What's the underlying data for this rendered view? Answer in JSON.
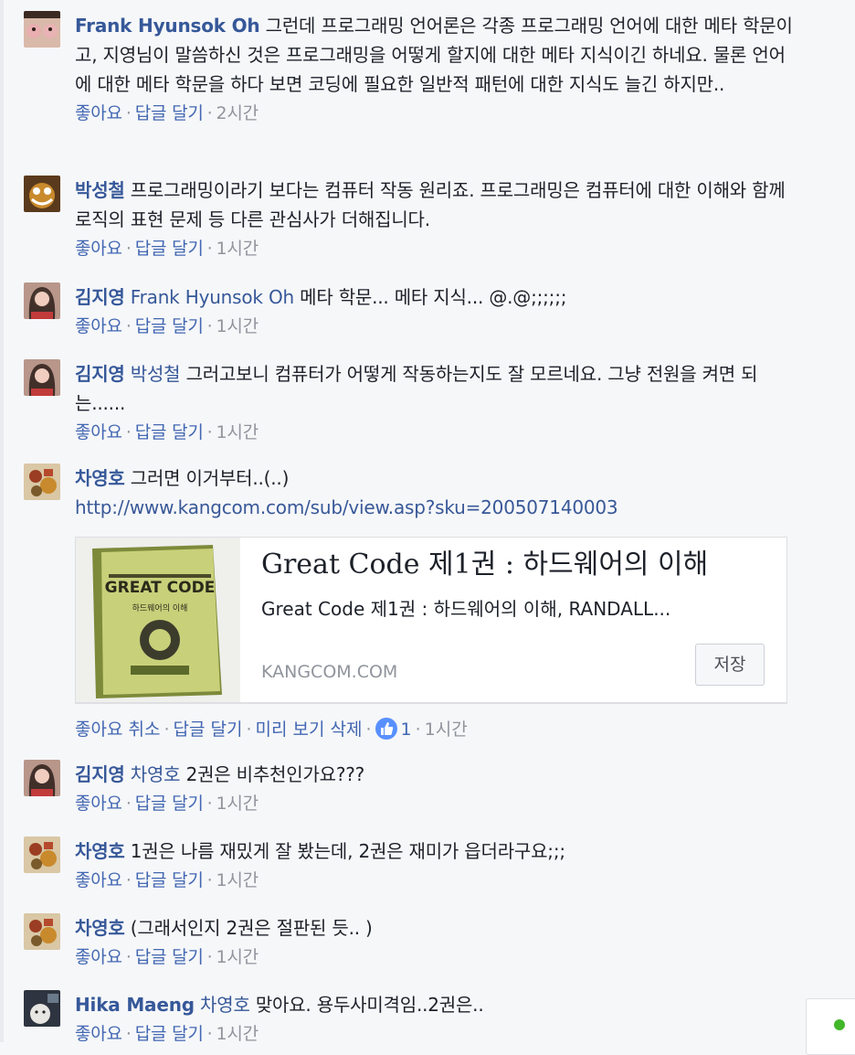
{
  "comments": [
    {
      "author": "Frank Hyunsok Oh",
      "mention": "",
      "text": "그런데 프로그래밍 언어론은 각종 프로그래밍 언어에 대한 메타 학문이고, 지영님이 말씀하신 것은 프로그래밍을 어떻게 할지에 대한 메타 지식이긴 하네요. 물론 언어에 대한 메타 학문을 하다 보면 코딩에 필요한 일반적 패턴에 대한 지식도 늘긴 하지만..",
      "like": "좋아요",
      "reply": "답글 달기",
      "time": "2시간"
    },
    {
      "author": "박성철",
      "mention": "",
      "text": "프로그래밍이라기 보다는 컴퓨터 작동 원리죠. 프로그래밍은 컴퓨터에 대한 이해와 함께 로직의 표현 문제 등 다른 관심사가 더해집니다.",
      "like": "좋아요",
      "reply": "답글 달기",
      "time": "1시간"
    },
    {
      "author": "김지영",
      "mention": "Frank Hyunsok Oh",
      "text": "메타 학문... 메타 지식... @.@;;;;;;",
      "like": "좋아요",
      "reply": "답글 달기",
      "time": "1시간"
    },
    {
      "author": "김지영",
      "mention": "박성철",
      "text": "그러고보니 컴퓨터가 어떻게 작동하는지도 잘 모르네요. 그냥 전원을 켜면 되는......",
      "like": "좋아요",
      "reply": "답글 달기",
      "time": "1시간"
    },
    {
      "author": "차영호",
      "mention": "",
      "text": "그러면 이거부터..(..)",
      "link": "http://www.kangcom.com/sub/view.asp?sku=200507140003",
      "like": "좋아요 취소",
      "reply": "답글 달기",
      "extra": "미리 보기 삭제",
      "like_count": "1",
      "time": "1시간"
    },
    {
      "author": "김지영",
      "mention": "차영호",
      "text": "2권은 비추천인가요???",
      "like": "좋아요",
      "reply": "답글 달기",
      "time": "1시간"
    },
    {
      "author": "차영호",
      "mention": "",
      "text": "1권은 나름 재밌게 잘 봤는데, 2권은 재미가 읍더라구요;;;",
      "like": "좋아요",
      "reply": "답글 달기",
      "time": "1시간"
    },
    {
      "author": "차영호",
      "mention": "",
      "text": "(그래서인지 2권은 절판된 듯.. )",
      "like": "좋아요",
      "reply": "답글 달기",
      "time": "1시간"
    },
    {
      "author": "Hika Maeng",
      "mention": "차영호",
      "text": "맞아요. 용두사미격임..2권은..",
      "like": "좋아요",
      "reply": "답글 달기",
      "time": "1시간"
    }
  ],
  "link_card": {
    "title": "Great Code 제1권 : 하드웨어의 이해",
    "description": "Great Code 제1권 : 하드웨어의 이해, RANDALL...",
    "domain": "KANGCOM.COM",
    "save_label": "저장",
    "cover_title": "GREAT CODE",
    "cover_subtitle": "하드웨어의 이해"
  },
  "colors": {
    "link": "#365899",
    "meta": "#90949c",
    "like_badge": "#5890ff",
    "online": "#42b72a"
  },
  "icons": {
    "like": "thumbs-up-icon",
    "presence": "online-dot-icon"
  }
}
